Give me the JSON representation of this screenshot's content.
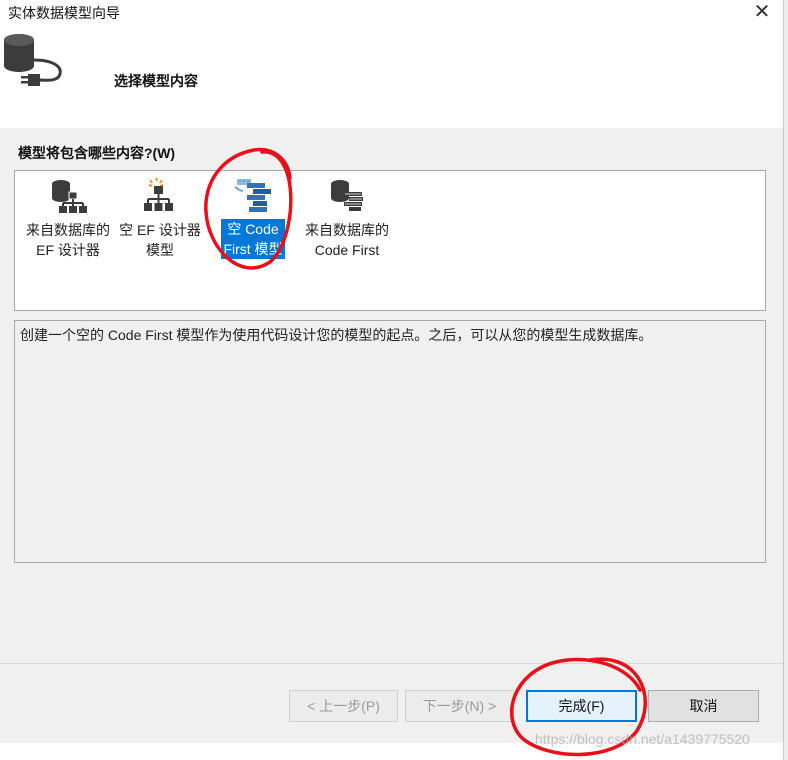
{
  "window": {
    "title": "实体数据模型向导",
    "close_glyph": "✕"
  },
  "header": {
    "icon": "database-plug-icon",
    "step_title": "选择模型内容"
  },
  "prompt": "模型将包含哪些内容?(W)",
  "model_options": [
    {
      "line1": "来自数据库的",
      "line2": "EF 设计器",
      "icon": "database-hierarchy-icon",
      "selected": false
    },
    {
      "line1": "空 EF 设计器",
      "line2": "模型",
      "icon": "empty-hierarchy-icon",
      "selected": false
    },
    {
      "line1": "空 Code",
      "line2": "First 模型",
      "icon": "code-first-icon",
      "selected": true
    },
    {
      "line1": "来自数据库的",
      "line2": "Code First",
      "icon": "database-code-first-icon",
      "selected": false
    }
  ],
  "description": "创建一个空的 Code First 模型作为使用代码设计您的模型的起点。之后，可以从您的模型生成数据库。",
  "buttons": {
    "prev": "< 上一步(P)",
    "next": "下一步(N) >",
    "finish": "完成(F)",
    "cancel": "取消"
  },
  "watermark": "https://blog.csdn.net/a1439775520",
  "colors": {
    "selection": "#0078d7",
    "annotation": "#e8101a",
    "background": "#f0f0f0"
  }
}
